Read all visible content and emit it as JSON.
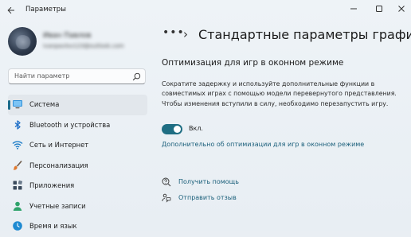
{
  "window": {
    "title": "Параметры"
  },
  "profile": {
    "name": "Иван Павлов",
    "email": "ivanpavlov123@outlook.com"
  },
  "search": {
    "placeholder": "Найти параметр"
  },
  "sidebar": {
    "items": [
      {
        "label": "Система",
        "icon": "system-display-icon",
        "active": true
      },
      {
        "label": "Bluetooth и устройства",
        "icon": "bluetooth-icon",
        "active": false
      },
      {
        "label": "Сеть и Интернет",
        "icon": "wifi-icon",
        "active": false
      },
      {
        "label": "Персонализация",
        "icon": "paint-brush-icon",
        "active": false
      },
      {
        "label": "Приложения",
        "icon": "apps-icon",
        "active": false
      },
      {
        "label": "Учетные записи",
        "icon": "account-icon",
        "active": false
      },
      {
        "label": "Время и язык",
        "icon": "time-language-icon",
        "active": false
      }
    ]
  },
  "breadcrumb": {
    "dots": "•••",
    "separator": "›",
    "current": "Стандартные параметры графи"
  },
  "main": {
    "section_title": "Оптимизация для игр в оконном режиме",
    "description": "Сократите задержку и используйте дополнительные функции в совместимых играх с помощью модели перевернутого представления. Чтобы изменения вступили в силу, необходимо перезапустить игру.",
    "toggle": {
      "state": "on",
      "label": "Вкл."
    },
    "more_link": "Дополнительно об оптимизации для игр в оконном режиме",
    "help_links": [
      {
        "label": "Получить помощь",
        "icon": "help-icon"
      },
      {
        "label": "Отправить отзыв",
        "icon": "feedback-icon"
      }
    ]
  },
  "colors": {
    "accent": "#1f6e83",
    "link": "#1a5f7a",
    "active_indicator": "#1a6b8a"
  }
}
